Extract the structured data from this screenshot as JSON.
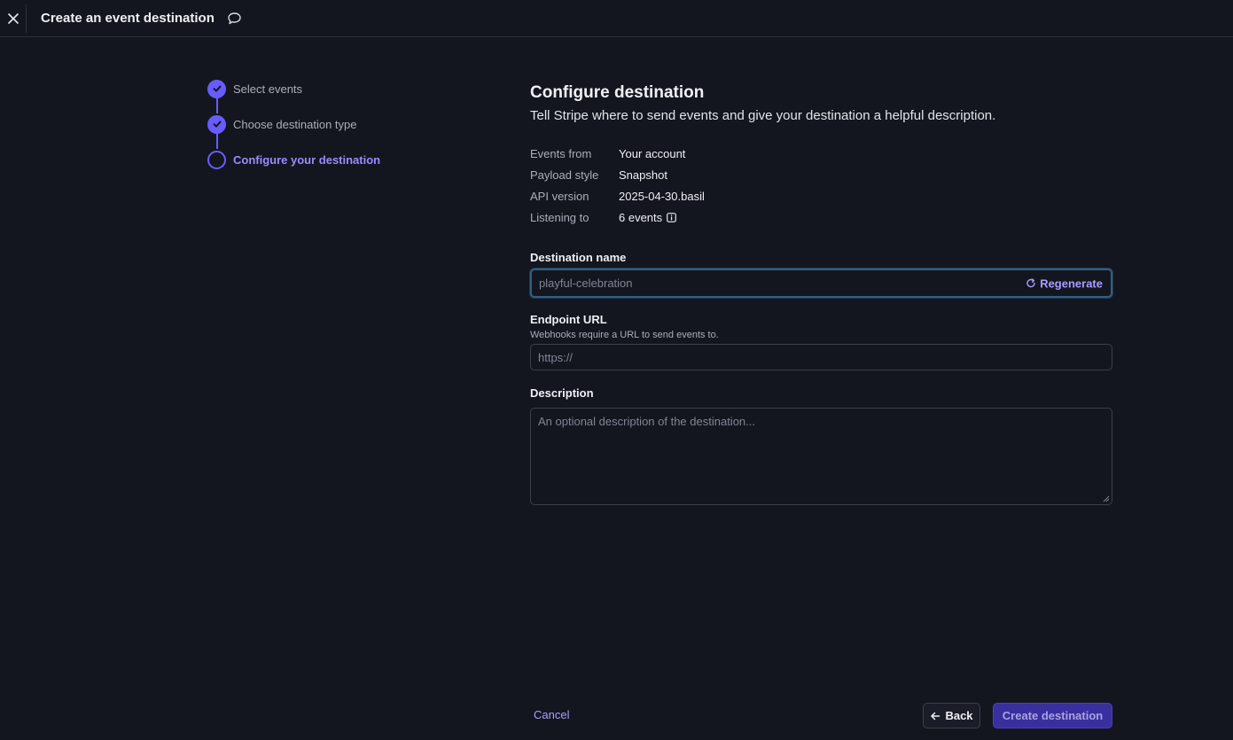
{
  "header": {
    "title": "Create an event destination"
  },
  "steps": [
    {
      "label": "Select events",
      "status": "done"
    },
    {
      "label": "Choose destination type",
      "status": "done"
    },
    {
      "label": "Configure your destination",
      "status": "current"
    }
  ],
  "main": {
    "title": "Configure destination",
    "subtitle": "Tell Stripe where to send events and give your destination a helpful description.",
    "meta": [
      {
        "key": "Events from",
        "value": "Your account"
      },
      {
        "key": "Payload style",
        "value": "Snapshot"
      },
      {
        "key": "API version",
        "value": "2025-04-30.basil"
      },
      {
        "key": "Listening to",
        "value": "6 events"
      }
    ],
    "destination_name": {
      "label": "Destination name",
      "placeholder": "playful-celebration",
      "regenerate_label": "Regenerate"
    },
    "endpoint_url": {
      "label": "Endpoint URL",
      "help": "Webhooks require a URL to send events to.",
      "placeholder": "https://"
    },
    "description": {
      "label": "Description",
      "placeholder": "An optional description of the destination..."
    }
  },
  "footer": {
    "cancel_label": "Cancel",
    "back_label": "Back",
    "create_label": "Create destination"
  },
  "colors": {
    "background": "#14161f",
    "accent": "#675dff",
    "link": "#a89dff",
    "primary_button_disabled": "#3a2f9e"
  }
}
